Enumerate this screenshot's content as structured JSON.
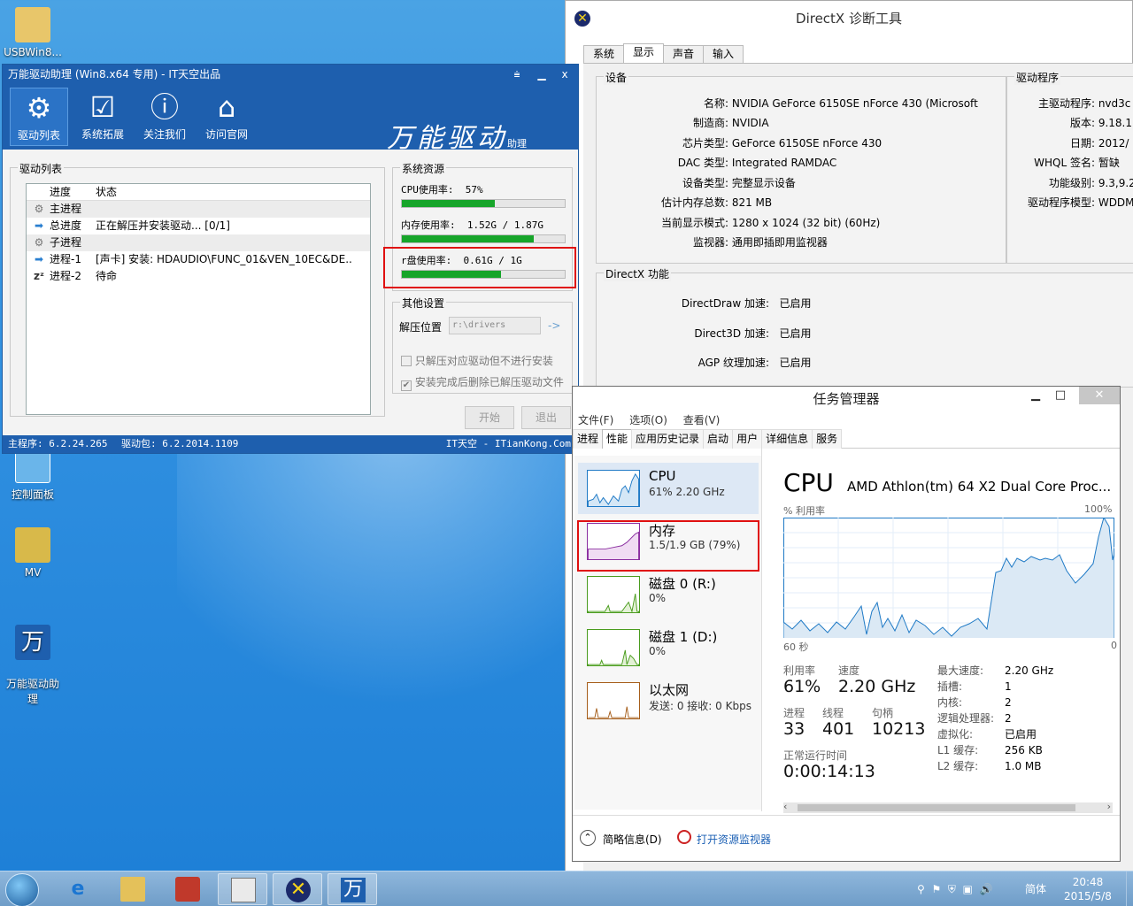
{
  "desktop": {
    "icons": [
      {
        "label": "USBWin8..."
      },
      {
        "label": "控制面板"
      },
      {
        "label": "MV"
      },
      {
        "label": "万能驱动助\n理"
      }
    ]
  },
  "wanneng": {
    "title": "万能驱动助理 (Win8.x64 专用) - IT天空出品",
    "controls": {
      "menu": "⩧",
      "min": "▁",
      "close": "x"
    },
    "toolbar": [
      {
        "label": "驱动列表",
        "icon": "gear-icon"
      },
      {
        "label": "系统拓展",
        "icon": "monitor-check-icon"
      },
      {
        "label": "关注我们",
        "icon": "info-icon"
      },
      {
        "label": "访问官网",
        "icon": "home-icon"
      }
    ],
    "brand": "万能驱动",
    "brand_suffix": "助理",
    "driver_list": {
      "label": "驱动列表",
      "headers": [
        "进度",
        "状态"
      ],
      "rows": [
        {
          "icon": "gear-icon",
          "name": "主进程",
          "status": ""
        },
        {
          "icon": "arrow-right-icon",
          "name": "总进度",
          "status": "正在解压并安装驱动... [0/1]"
        },
        {
          "icon": "gear-icon",
          "name": "子进程",
          "status": ""
        },
        {
          "icon": "arrow-right-icon",
          "name": "进程-1",
          "status": "[声卡] 安装: HDAUDIO\\FUNC_01&VEN_10EC&DE..."
        },
        {
          "icon": "sleep-icon",
          "name": "进程-2",
          "status": "待命"
        }
      ]
    },
    "resources": {
      "label": "系统资源",
      "cpu": {
        "label": "CPU使用率:",
        "value": "57%",
        "fraction": 0.57
      },
      "mem": {
        "label": "内存使用率:",
        "value": "1.52G / 1.87G",
        "fraction": 0.81
      },
      "rdisk": {
        "label": "r盘使用率:",
        "value": "0.61G / 1G",
        "fraction": 0.61
      }
    },
    "other": {
      "label": "其他设置",
      "extract_label": "解压位置",
      "extract_value": "r:\\drivers",
      "arrow": "->",
      "opt1": "只解压对应驱动但不进行安装",
      "opt2": "安装完成后删除已解压驱动文件"
    },
    "buttons": {
      "start": "开始",
      "exit": "退出"
    },
    "status": {
      "main": "主程序: 6.2.24.265",
      "pkg": "驱动包: 6.2.2014.1109",
      "site": "IT天空 - ITianKong.Com"
    }
  },
  "directx": {
    "title": "DirectX 诊断工具",
    "tabs": [
      "系统",
      "显示",
      "声音",
      "输入"
    ],
    "device": {
      "label": "设备",
      "rows": [
        {
          "k": "名称:",
          "v": "NVIDIA GeForce 6150SE nForce 430 (Microsoft"
        },
        {
          "k": "制造商:",
          "v": "NVIDIA"
        },
        {
          "k": "芯片类型:",
          "v": "GeForce 6150SE nForce 430"
        },
        {
          "k": "DAC 类型:",
          "v": "Integrated RAMDAC"
        },
        {
          "k": "设备类型:",
          "v": "完整显示设备"
        },
        {
          "k": "估计内存总数:",
          "v": "821 MB"
        },
        {
          "k": "当前显示模式:",
          "v": "1280 x 1024 (32 bit) (60Hz)"
        },
        {
          "k": "监视器:",
          "v": "通用即插即用监视器"
        }
      ]
    },
    "driver": {
      "label": "驱动程序",
      "rows": [
        {
          "k": "主驱动程序:",
          "v": "nvd3c"
        },
        {
          "k": "版本:",
          "v": "9.18.1"
        },
        {
          "k": "日期:",
          "v": "2012/"
        },
        {
          "k": "WHQL 签名:",
          "v": "暂缺"
        },
        {
          "k": "功能级别:",
          "v": "9.3,9.2"
        },
        {
          "k": "驱动程序模型:",
          "v": "WDDM"
        }
      ]
    },
    "features": {
      "label": "DirectX 功能",
      "rows": [
        {
          "k": "DirectDraw 加速:",
          "v": "已启用"
        },
        {
          "k": "Direct3D 加速:",
          "v": "已启用"
        },
        {
          "k": "AGP 纹理加速:",
          "v": "已启用"
        }
      ]
    }
  },
  "taskmgr": {
    "title": "任务管理器",
    "menu": [
      "文件(F)",
      "选项(O)",
      "查看(V)"
    ],
    "tabs": [
      "进程",
      "性能",
      "应用历史记录",
      "启动",
      "用户",
      "详细信息",
      "服务"
    ],
    "side": [
      {
        "name": "CPU",
        "sub": "61% 2.20 GHz",
        "color": "#1f7ac6"
      },
      {
        "name": "内存",
        "sub": "1.5/1.9 GB (79%)",
        "color": "#8b2fa0"
      },
      {
        "name": "磁盘 0 (R:)",
        "sub": "0%",
        "color": "#4a9c1e"
      },
      {
        "name": "磁盘 1 (D:)",
        "sub": "0%",
        "color": "#4a9c1e"
      },
      {
        "name": "以太网",
        "sub": "发送: 0 接收: 0 Kbps",
        "color": "#a65e1a"
      }
    ],
    "main": {
      "heading": "CPU",
      "cpu_name": "AMD Athlon(tm) 64 X2 Dual Core Proc...",
      "util_label": "% 利用率",
      "max_label": "100%",
      "time_label": "60 秒",
      "zero_label": "0",
      "stats": {
        "util_lbl": "利用率",
        "util": "61%",
        "speed_lbl": "速度",
        "speed": "2.20 GHz",
        "proc_lbl": "进程",
        "proc": "33",
        "thread_lbl": "线程",
        "thread": "401",
        "handle_lbl": "句柄",
        "handle": "10213",
        "uptime_lbl": "正常运行时间",
        "uptime": "0:00:14:13"
      },
      "specs": [
        {
          "k": "最大速度:",
          "v": "2.20 GHz"
        },
        {
          "k": "插槽:",
          "v": "1"
        },
        {
          "k": "内核:",
          "v": "2"
        },
        {
          "k": "逻辑处理器:",
          "v": "2"
        },
        {
          "k": "虚拟化:",
          "v": "已启用"
        },
        {
          "k": "L1 缓存:",
          "v": "256 KB"
        },
        {
          "k": "L2 缓存:",
          "v": "1.0 MB"
        }
      ]
    },
    "footer": {
      "less": "简略信息(D)",
      "monitor": "打开资源监视器"
    }
  },
  "taskbar": {
    "ime": "简体",
    "time": "20:48",
    "date": "2015/5/8"
  }
}
